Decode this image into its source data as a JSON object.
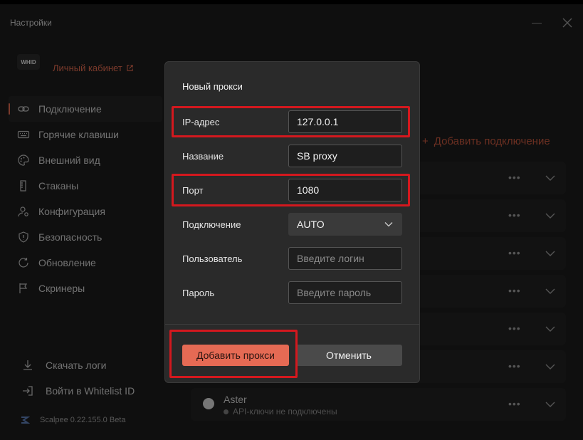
{
  "window": {
    "title": "Настройки"
  },
  "sidebar": {
    "logo_text": "WHID",
    "cabinet_label": "Личный кабинет",
    "items": [
      {
        "label": "Подключение",
        "icon": "link-icon",
        "active": true
      },
      {
        "label": "Горячие клавиши",
        "icon": "keyboard-icon"
      },
      {
        "label": "Внешний вид",
        "icon": "palette-icon"
      },
      {
        "label": "Стаканы",
        "icon": "book-icon"
      },
      {
        "label": "Конфигурация",
        "icon": "user-gear-icon"
      },
      {
        "label": "Безопасность",
        "icon": "shield-icon"
      },
      {
        "label": "Обновление",
        "icon": "refresh-icon"
      },
      {
        "label": "Скринеры",
        "icon": "flag-icon"
      }
    ],
    "bottom": [
      {
        "label": "Скачать логи",
        "icon": "download-icon"
      },
      {
        "label": "Войти в Whitelist ID",
        "icon": "login-icon"
      }
    ],
    "version": "Scalpee 0.22.155.0 Beta"
  },
  "main": {
    "add_connection": "Добавить подключение",
    "aster": {
      "name": "Aster",
      "status": "API-ключи не подключены"
    }
  },
  "modal": {
    "title": "Новый прокси",
    "fields": {
      "ip": {
        "label": "IP-адрес",
        "value": "127.0.0.1"
      },
      "name": {
        "label": "Название",
        "value": "SB proxy"
      },
      "port": {
        "label": "Порт",
        "value": "1080"
      },
      "connection": {
        "label": "Подключение",
        "value": "AUTO"
      },
      "user": {
        "label": "Пользователь",
        "placeholder": "Введите логин"
      },
      "password": {
        "label": "Пароль",
        "placeholder": "Введите пароль"
      }
    },
    "buttons": {
      "add": "Добавить прокси",
      "cancel": "Отменить"
    }
  },
  "colors": {
    "accent": "#e56a54",
    "highlight": "#d4181e",
    "background": "#1c1c1c",
    "modal": "#2a2a2a"
  }
}
